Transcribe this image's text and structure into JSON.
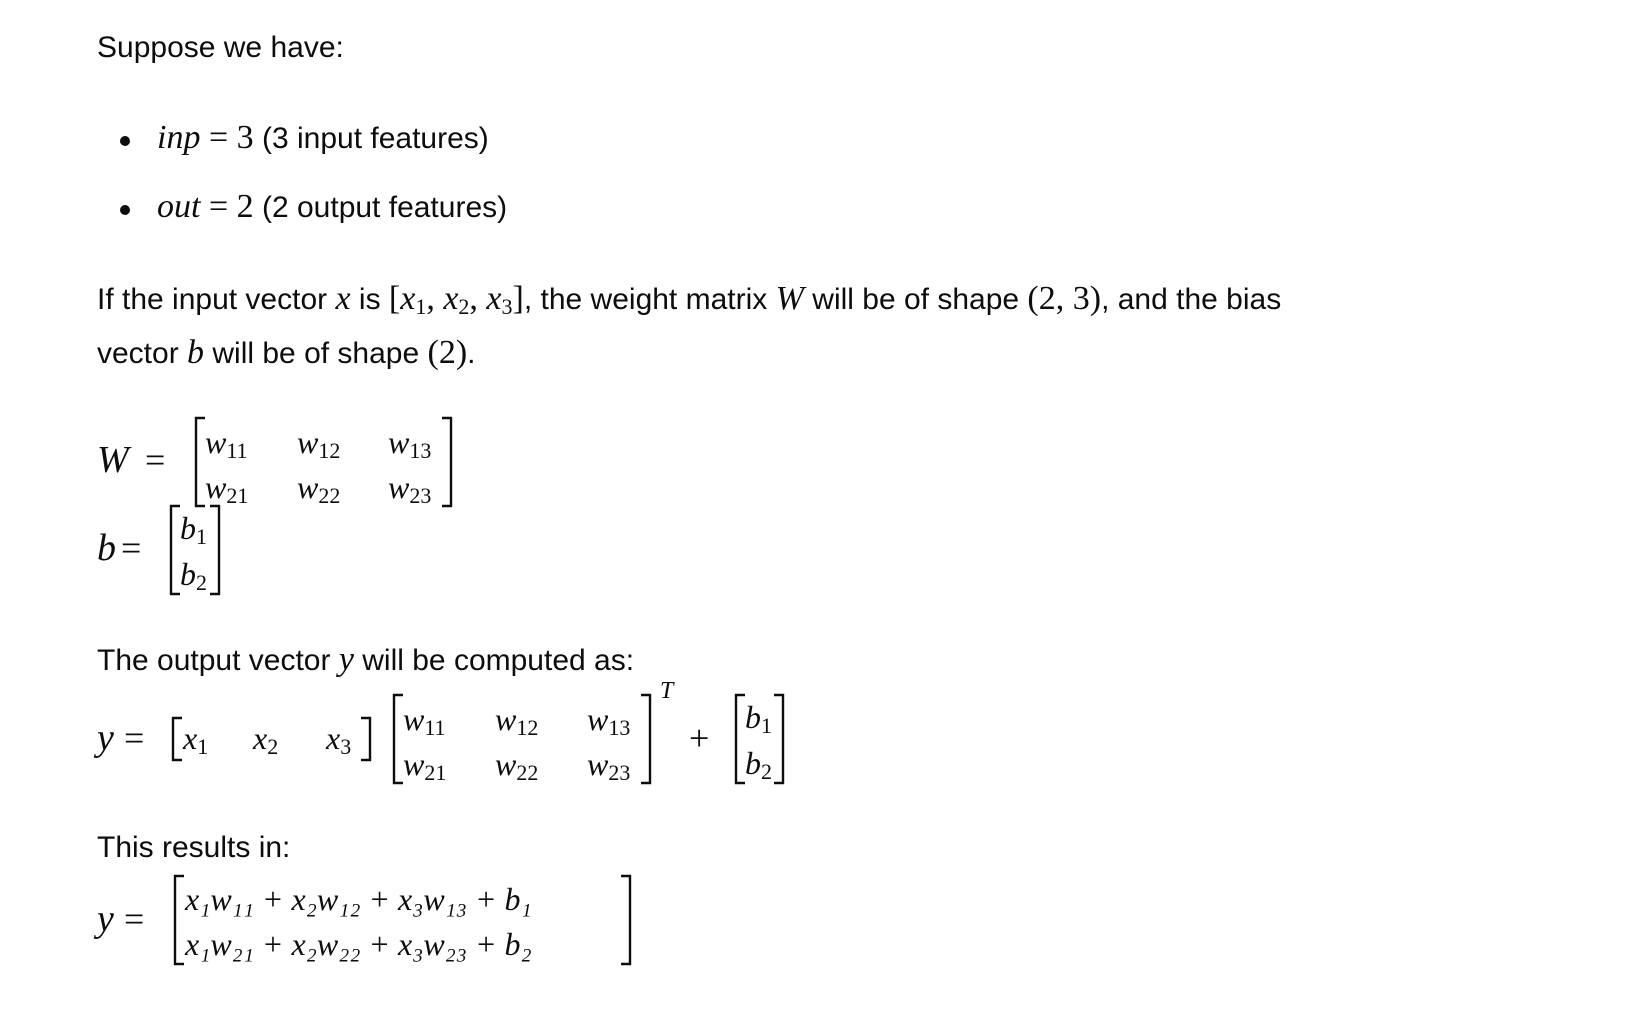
{
  "intro": "Suppose we have:",
  "bullets": [
    {
      "var": "inp",
      "eq": " = ",
      "val": "3",
      "desc": " (3 input features)"
    },
    {
      "var": "out",
      "eq": " = ",
      "val": "2",
      "desc": " (2 output features)"
    }
  ],
  "para": {
    "t1": "If the input vector ",
    "x": "x",
    "t2": " is ",
    "xvec_open": "[",
    "x1": "x",
    "s1": "1",
    "comma1": ", ",
    "x2": "x",
    "s2": "2",
    "comma2": ", ",
    "x3": "x",
    "s3": "3",
    "xvec_close": "]",
    "t3": ", the weight matrix ",
    "W": "W",
    "t4": " will be of shape ",
    "shapeW": "(2, 3)",
    "t5": ", and the bias",
    "t6": "vector ",
    "b": "b",
    "t7": " will be of shape ",
    "shapeB": "(2)",
    "t8": "."
  },
  "w_label": "W",
  "b_label": "b",
  "eq_sign": "=",
  "w_matrix": [
    [
      "w",
      "11",
      "w",
      "12",
      "w",
      "13"
    ],
    [
      "w",
      "21",
      "w",
      "22",
      "w",
      "23"
    ]
  ],
  "output_text": {
    "t1": "The output vector ",
    "y": "y",
    "t2": " will be computed as:"
  },
  "y_label": "y",
  "x_row": [
    "x",
    "1",
    "x",
    "2",
    "x",
    "3"
  ],
  "transpose": "T",
  "plus": "+",
  "b_vector": [
    [
      "b",
      "1"
    ],
    [
      "b",
      "2"
    ]
  ],
  "results_text": "This results in:",
  "result_rows": [
    "x₁w₁₁ + x₂w₁₂ + x₃w₁₃ + b₁",
    "x₁w₂₁ + x₂w₂₂ + x₃w₂₃ + b₂"
  ]
}
